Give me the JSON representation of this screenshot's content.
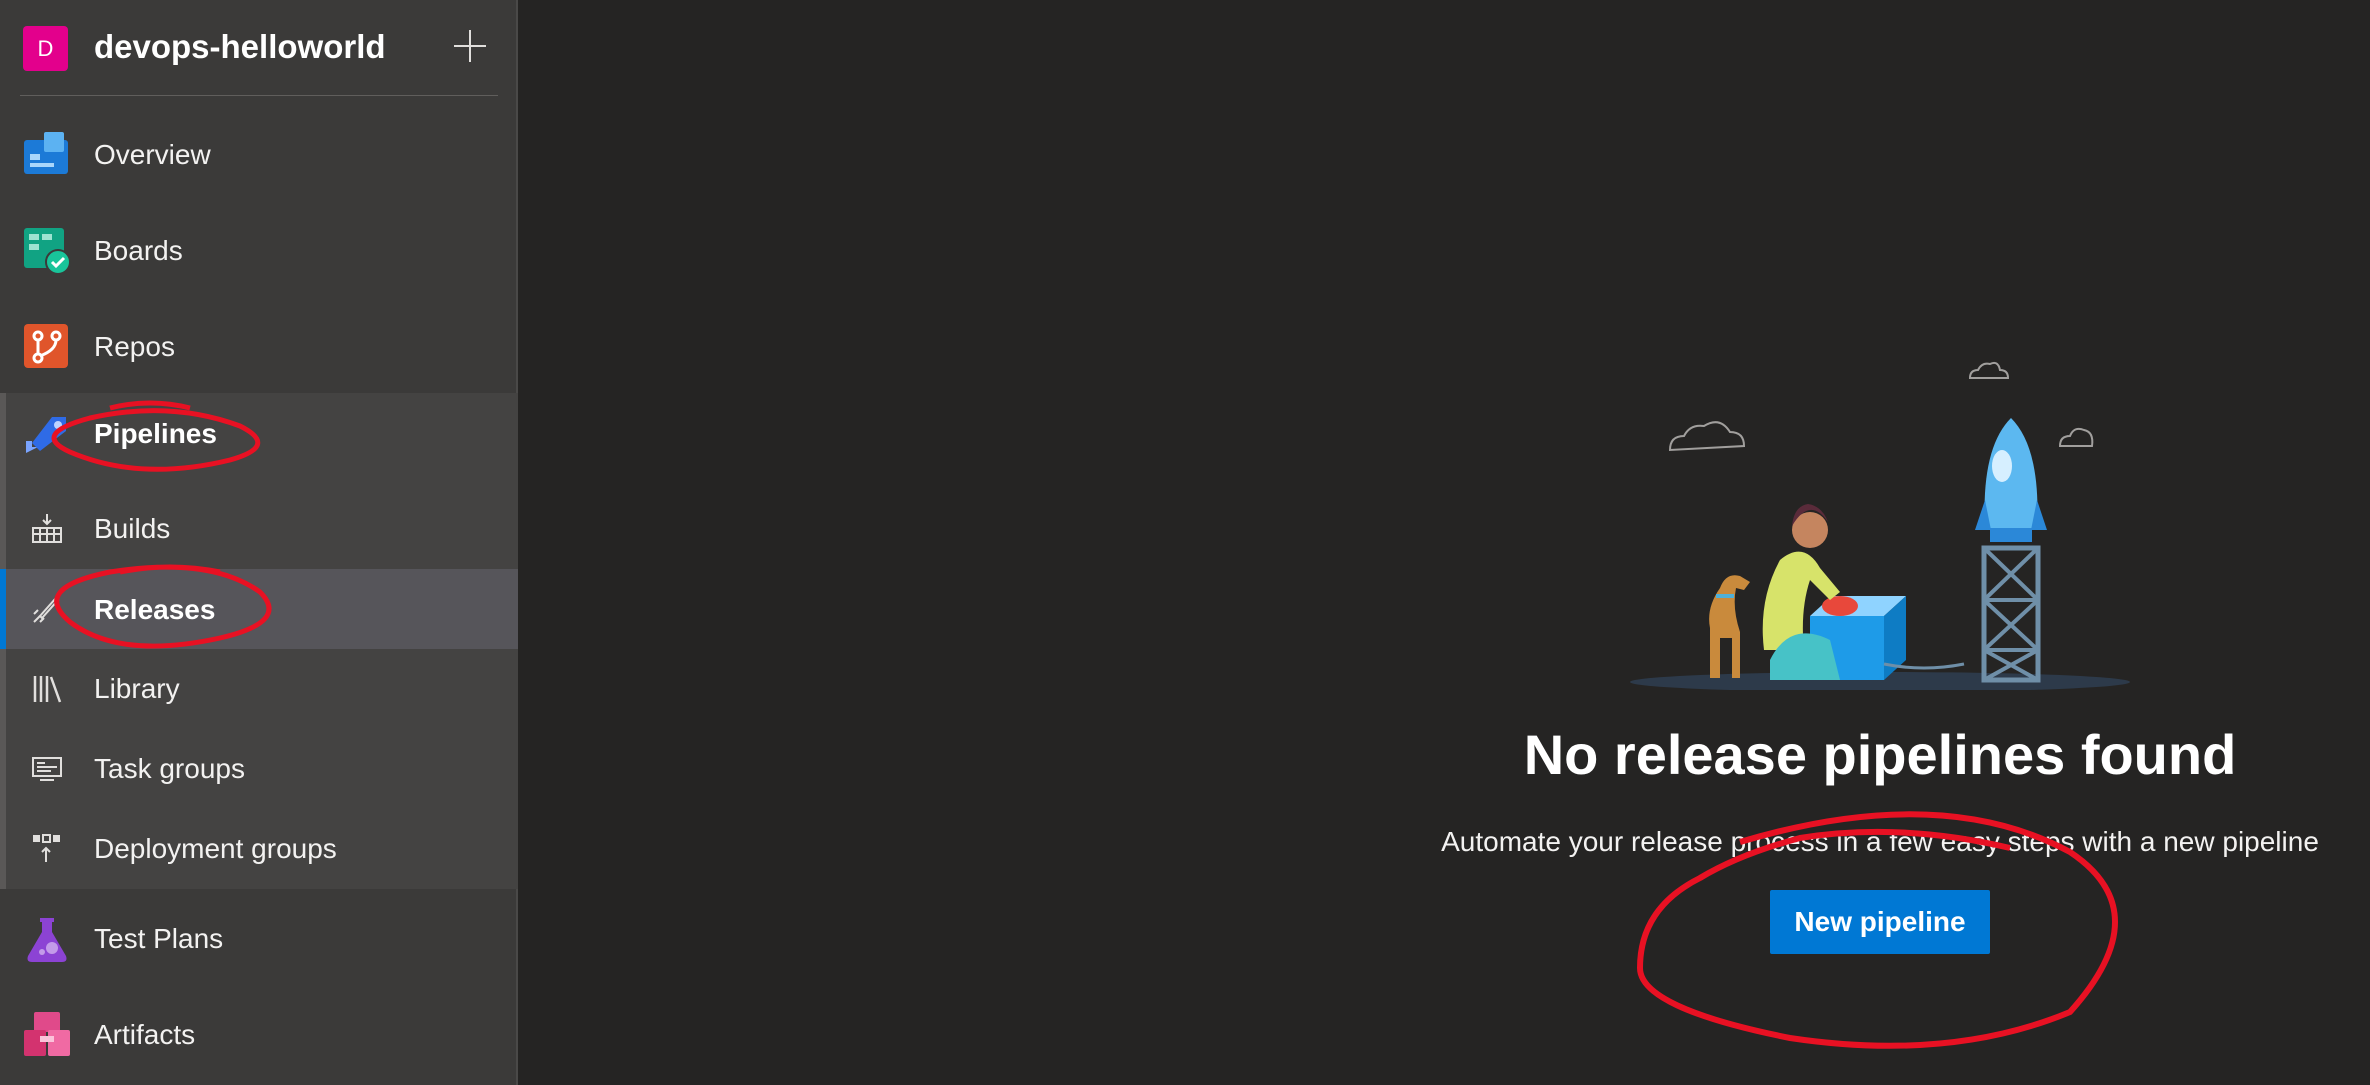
{
  "project": {
    "avatar_letter": "D",
    "name": "devops-helloworld",
    "avatar_color": "#e3008c"
  },
  "nav": {
    "overview": "Overview",
    "boards": "Boards",
    "repos": "Repos",
    "pipelines": "Pipelines",
    "builds": "Builds",
    "releases": "Releases",
    "library": "Library",
    "task_groups": "Task groups",
    "deployment_groups": "Deployment groups",
    "test_plans": "Test Plans",
    "artifacts": "Artifacts"
  },
  "empty_state": {
    "title": "No release pipelines found",
    "subtitle": "Automate your release process in a few easy steps with a new pipeline",
    "button": "New pipeline"
  },
  "colors": {
    "accent": "#0078d4",
    "annotation": "#e81123"
  }
}
